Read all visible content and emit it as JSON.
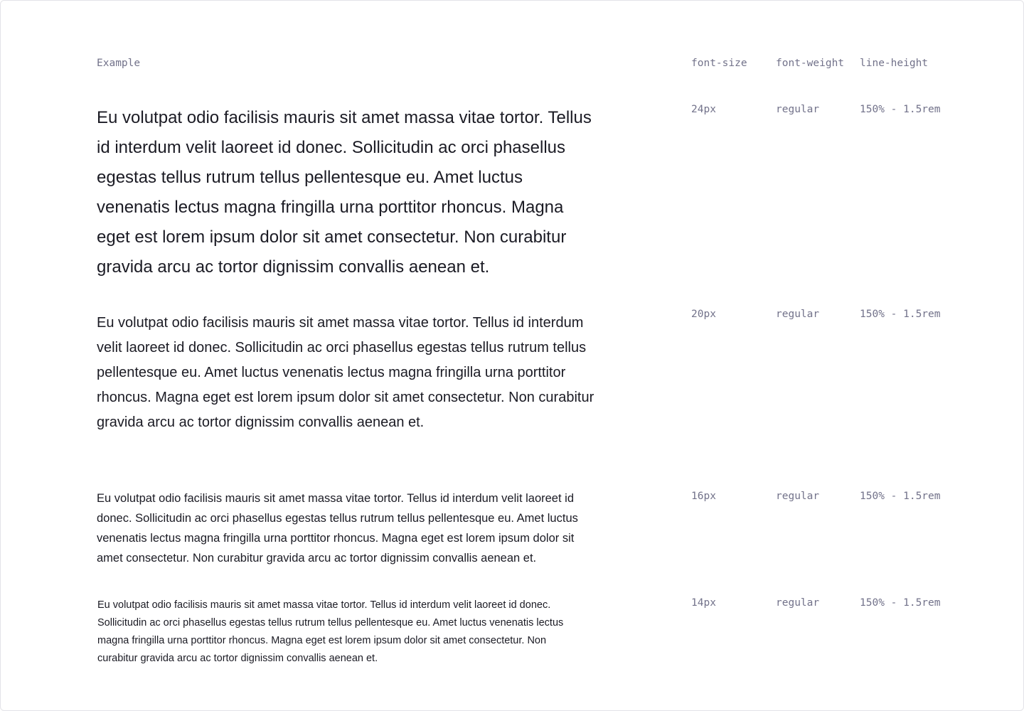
{
  "header": {
    "example": "Example",
    "font_size": "font-size",
    "font_weight": "font-weight",
    "line_height": "line-height"
  },
  "rows": [
    {
      "text": "Eu volutpat odio facilisis mauris sit amet massa vitae tortor. Tellus id interdum velit laoreet id donec. Sollicitudin ac orci phasellus egestas tellus rutrum tellus pellentesque eu. Amet luctus venenatis lectus magna fringilla urna porttitor rhoncus. Magna eget est lorem ipsum dolor sit amet consectetur. Non curabitur gravida arcu ac tortor dignissim convallis aenean et.",
      "font_size": "24px",
      "font_weight": "regular",
      "line_height": "150% - 1.5rem"
    },
    {
      "text": "Eu volutpat odio facilisis mauris sit amet massa vitae tortor. Tellus id interdum velit laoreet id donec. Sollicitudin ac orci phasellus egestas tellus rutrum tellus pellentesque eu. Amet luctus venenatis lectus magna fringilla urna porttitor rhoncus. Magna eget est lorem ipsum dolor sit amet consectetur. Non curabitur gravida arcu ac tortor dignissim convallis aenean et.",
      "font_size": "20px",
      "font_weight": "regular",
      "line_height": "150% - 1.5rem"
    },
    {
      "text": "Eu volutpat odio facilisis mauris sit amet massa vitae tortor. Tellus id interdum velit laoreet id donec. Sollicitudin ac orci phasellus egestas tellus rutrum tellus pellentesque eu. Amet luctus venenatis lectus magna fringilla urna porttitor rhoncus. Magna eget est lorem ipsum dolor sit amet consectetur. Non curabitur gravida arcu ac tortor dignissim convallis aenean et.",
      "font_size": "16px",
      "font_weight": "regular",
      "line_height": "150% - 1.5rem"
    },
    {
      "text": "Eu volutpat odio facilisis mauris sit amet massa vitae tortor. Tellus id interdum velit laoreet id donec. Sollicitudin ac orci phasellus egestas tellus rutrum tellus pellentesque eu. Amet luctus venenatis lectus magna fringilla urna porttitor rhoncus. Magna eget est lorem ipsum dolor sit amet consectetur. Non curabitur gravida arcu ac tortor dignissim convallis aenean et.",
      "font_size": "14px",
      "font_weight": "regular",
      "line_height": "150% - 1.5rem"
    }
  ],
  "colors": {
    "text": "#1b1b24",
    "meta": "#72728a",
    "border": "#e3e3e8"
  }
}
